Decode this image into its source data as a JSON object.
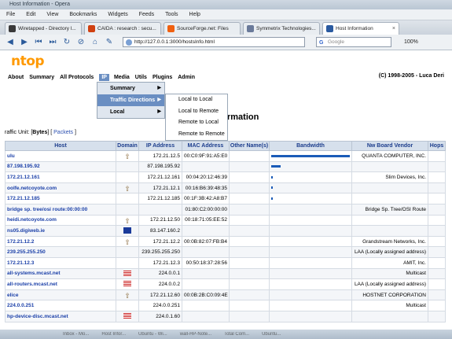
{
  "window": {
    "title": "Host Information - Opera"
  },
  "menubar": [
    "File",
    "Edit",
    "View",
    "Bookmarks",
    "Widgets",
    "Feeds",
    "Tools",
    "Help"
  ],
  "tabs": [
    {
      "label": "Wiretapped - Directory l...",
      "color": "#3a3a3a"
    },
    {
      "label": "CAIDA : research : secu...",
      "color": "#d04010"
    },
    {
      "label": "SourceForge.net: Files",
      "color": "#f06010"
    },
    {
      "label": "Symmetrix Technologies...",
      "color": "#6a7a9a"
    },
    {
      "label": "Host Information",
      "color": "#2a5aa0"
    }
  ],
  "address_bar": {
    "url": "http://127.0.0.1:3000/hostsInfo.html",
    "search_placeholder": "Google",
    "zoom": "100%"
  },
  "logo": "ntop",
  "nav": {
    "items": [
      "About",
      "Summary",
      "All Protocols",
      "IP",
      "Media",
      "Utils",
      "Plugins",
      "Admin"
    ],
    "copyright": "(C) 1998-2005 - Luca Deri"
  },
  "ip_menu": [
    "Summary",
    "Traffic Directions",
    "Local"
  ],
  "traffic_submenu": [
    "Local to Local",
    "Local to Remote",
    "Remote to Local",
    "Remote to Remote"
  ],
  "page": {
    "title": "rmation",
    "traffic_unit_label": "raffic Unit: [",
    "bytes": "Bytes",
    "packets": "Packets"
  },
  "table": {
    "headers": [
      "Host",
      "Domain",
      "IP Address",
      "MAC Address",
      "Other Name(s)",
      "Bandwidth",
      "Nw Board Vendor",
      "Hops"
    ],
    "rows": [
      {
        "host": "ulu",
        "domain": "arrow",
        "ip": "172.21.12.5",
        "mac": "00:C0:9F:91:A5:E0",
        "bw": 100,
        "vendor": "QUANTA COMPUTER, INC."
      },
      {
        "host": "87.198.195.92",
        "domain": "",
        "ip": "87.198.195.92",
        "mac": "",
        "bw": 12,
        "vendor": ""
      },
      {
        "host": "172.21.12.161",
        "domain": "",
        "ip": "172.21.12.161",
        "mac": "00:04:20:12:46:39",
        "bw": 2,
        "vendor": "Slim Devices, Inc."
      },
      {
        "host": "oolfe.netcoyote.com",
        "domain": "arrow",
        "ip": "172.21.12.1",
        "mac": "00:16:B6:39:48:35",
        "bw": 1,
        "vendor": ""
      },
      {
        "host": "172.21.12.185",
        "domain": "",
        "ip": "172.21.12.185",
        "mac": "00:1F:3B:42:A8:B7",
        "bw": 1,
        "vendor": ""
      },
      {
        "host": "bridge sp. tree/osi route:00:00:00",
        "domain": "",
        "ip": "",
        "mac": "01:80:C2:00:00:00",
        "bw": 0,
        "vendor": "Bridge Sp. Tree/OSI Route"
      },
      {
        "host": "heidi.netcoyote.com",
        "domain": "arrow",
        "ip": "172.21.12.50",
        "mac": "00:18:71:05:EE:52",
        "bw": 0,
        "vendor": ""
      },
      {
        "host": "ns05.digiweb.ie",
        "domain": "eu",
        "ip": "83.147.160.2",
        "mac": "",
        "bw": 0,
        "vendor": ""
      },
      {
        "host": "172.21.12.2",
        "domain": "arrow",
        "ip": "172.21.12.2",
        "mac": "00:0B:82:07:FB:B4",
        "bw": 0,
        "vendor": "Grandstream Networks, Inc."
      },
      {
        "host": "239.255.255.250",
        "domain": "",
        "ip": "239.255.255.250",
        "mac": "",
        "bw": 0,
        "vendor": "LAA (Locally assigned address)"
      },
      {
        "host": "172.21.12.3",
        "domain": "",
        "ip": "172.21.12.3",
        "mac": "00:50:18:37:28:56",
        "bw": 0,
        "vendor": "AMIT, Inc."
      },
      {
        "host": "all-systems.mcast.net",
        "domain": "us",
        "ip": "224.0.0.1",
        "mac": "",
        "bw": 0,
        "vendor": "Multicast"
      },
      {
        "host": "all-routers.mcast.net",
        "domain": "us",
        "ip": "224.0.0.2",
        "mac": "",
        "bw": 0,
        "vendor": "LAA (Locally assigned address)"
      },
      {
        "host": "elice",
        "domain": "arrow",
        "ip": "172.21.12.60",
        "mac": "00:0B:2B:C0:09:4E",
        "bw": 0,
        "vendor": "HOSTNET CORPORATION"
      },
      {
        "host": "224.0.0.251",
        "domain": "",
        "ip": "224.0.0.251",
        "mac": "",
        "bw": 0,
        "vendor": "Multicast"
      },
      {
        "host": "hp-device-disc.mcast.net",
        "domain": "us",
        "ip": "224.0.1.60",
        "mac": "",
        "bw": 0,
        "vendor": ""
      }
    ]
  },
  "taskbar": [
    "Inbox - Mo...",
    "Host Infor...",
    "Ubuntu - Wi...",
    "wall-HP-Note...",
    "Total Com...",
    "Ubuntu..."
  ]
}
